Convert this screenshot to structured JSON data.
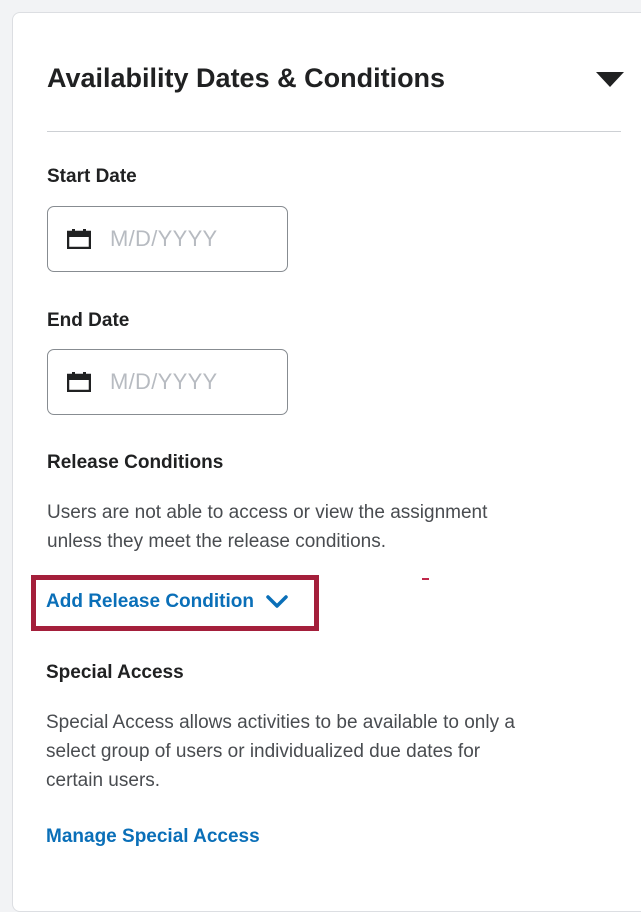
{
  "panel": {
    "title": "Availability Dates & Conditions",
    "collapse_icon": "caret-down-icon"
  },
  "start_date": {
    "label": "Start Date",
    "placeholder": "M/D/YYYY",
    "icon": "calendar-icon"
  },
  "end_date": {
    "label": "End Date",
    "placeholder": "M/D/YYYY",
    "icon": "calendar-icon"
  },
  "release_conditions": {
    "heading": "Release Conditions",
    "description_line1": "Users are not able to access or view the assignment",
    "description_line2": "unless they meet the release conditions.",
    "add_label": "Add Release Condition",
    "add_icon": "chevron-down-icon",
    "highlight_color": "#a41f3b"
  },
  "special_access": {
    "heading": "Special Access",
    "description_line1": "Special Access allows activities to be available to only a",
    "description_line2": "select group of users or individualized due dates for",
    "description_line3": "certain users.",
    "manage_label": "Manage Special Access"
  },
  "colors": {
    "link": "#0a6fb8",
    "text": "#202122",
    "muted_text": "#494c50",
    "placeholder": "#b7bbc1"
  }
}
